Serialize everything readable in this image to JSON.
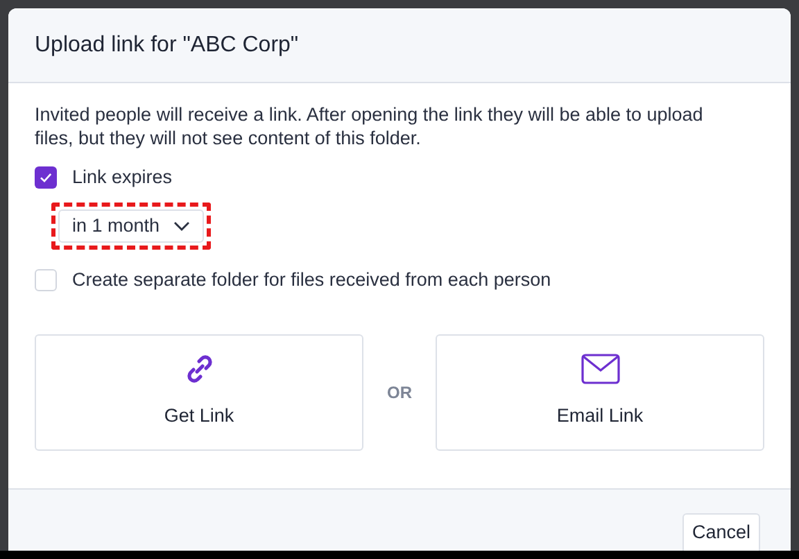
{
  "dialog": {
    "title": "Upload link for \"ABC Corp\"",
    "description": "Invited people will receive a link. After opening the link they will be able to upload files, but they will not see content of this folder.",
    "options": [
      {
        "label": "Link expires",
        "checked": true
      },
      {
        "label": "Create separate folder for files received from each person",
        "checked": false
      }
    ],
    "expiry": {
      "value": "in 1 month",
      "highlighted": true
    },
    "actions": [
      {
        "kind": "link",
        "label": "Get Link"
      },
      {
        "kind": "email",
        "label": "Email Link"
      }
    ],
    "separator": "OR",
    "footer_buttons": [
      "Cancel"
    ]
  }
}
